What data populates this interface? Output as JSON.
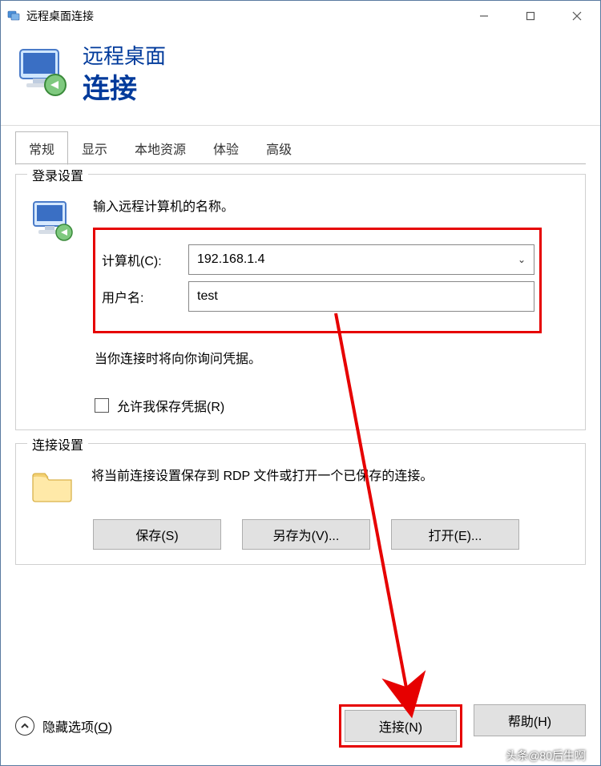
{
  "titlebar": {
    "title": "远程桌面连接"
  },
  "header": {
    "line1": "远程桌面",
    "line2": "连接"
  },
  "tabs": {
    "general": "常规",
    "display": "显示",
    "local": "本地资源",
    "experience": "体验",
    "advanced": "高级"
  },
  "login": {
    "legend": "登录设置",
    "prompt": "输入远程计算机的名称。",
    "computer_label": "计算机(C):",
    "computer_value": "192.168.1.4",
    "username_label": "用户名:",
    "username_value": "test",
    "cred_note": "当你连接时将向你询问凭据。",
    "save_cred_label": "允许我保存凭据(R)"
  },
  "connection": {
    "legend": "连接设置",
    "desc": "将当前连接设置保存到 RDP 文件或打开一个已保存的连接。",
    "save": "保存(S)",
    "saveas": "另存为(V)...",
    "open": "打开(E)..."
  },
  "footer": {
    "hide_pre": "隐藏选项(",
    "hide_ul": "O",
    "hide_post": ")",
    "connect": "连接(N)",
    "help": "帮助(H)"
  },
  "watermark": "头条@80后生啊"
}
